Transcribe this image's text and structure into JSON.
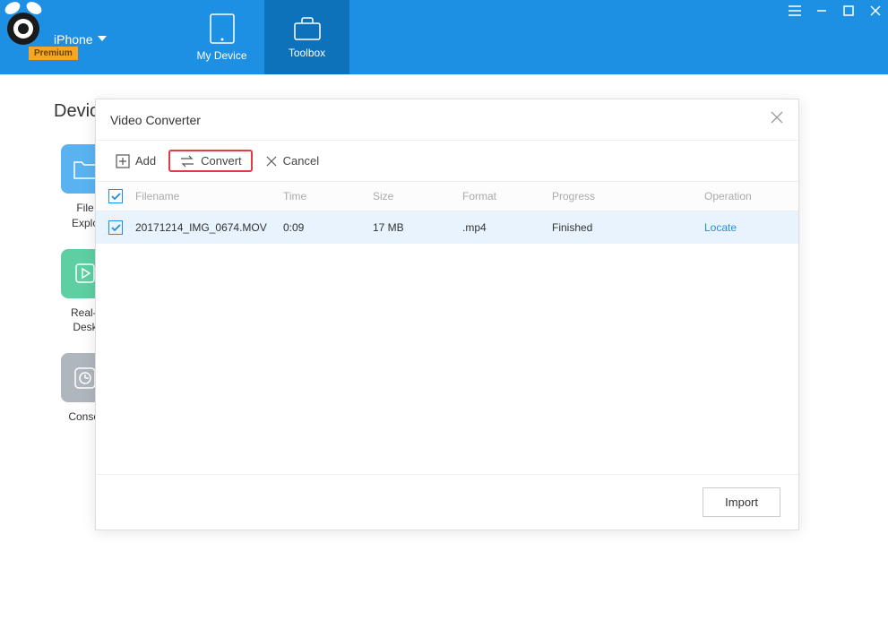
{
  "header": {
    "device_name": "iPhone",
    "premium_label": "Premium",
    "tabs": [
      {
        "label": "My Device"
      },
      {
        "label": "Toolbox"
      }
    ]
  },
  "page": {
    "heading": "Devic"
  },
  "tools": [
    {
      "label": "File\nExplo",
      "color": "blue"
    },
    {
      "label": "Real-t\nDesk",
      "color": "green"
    },
    {
      "label": "Consol",
      "color": "gray"
    }
  ],
  "modal": {
    "title": "Video Converter",
    "toolbar": {
      "add_label": "Add",
      "convert_label": "Convert",
      "cancel_label": "Cancel"
    },
    "columns": {
      "filename": "Filename",
      "time": "Time",
      "size": "Size",
      "format": "Format",
      "progress": "Progress",
      "operation": "Operation"
    },
    "rows": [
      {
        "filename": "20171214_IMG_0674.MOV",
        "time": "0:09",
        "size": "17 MB",
        "format": ".mp4",
        "progress": "Finished",
        "operation": "Locate"
      }
    ],
    "footer": {
      "import_label": "Import"
    }
  }
}
